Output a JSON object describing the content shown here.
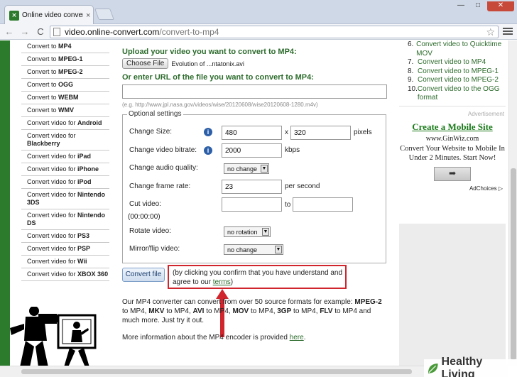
{
  "browser": {
    "tab_title": "Online video converter to",
    "tab_close": "×",
    "url_host": "video.online-convert.com",
    "url_path": "/convert-to-mp4",
    "back": "←",
    "forward": "→",
    "reload": "C",
    "star": "☆",
    "minimize": "—",
    "maximize": "□",
    "close": "✕"
  },
  "sidebar": {
    "items": [
      {
        "prefix": "Convert to ",
        "bold": "MP4"
      },
      {
        "prefix": "Convert to ",
        "bold": "MPEG-1"
      },
      {
        "prefix": "Convert to ",
        "bold": "MPEG-2"
      },
      {
        "prefix": "Convert to ",
        "bold": "OGG"
      },
      {
        "prefix": "Convert to ",
        "bold": "WEBM"
      },
      {
        "prefix": "Convert to ",
        "bold": "WMV"
      },
      {
        "prefix": "Convert video for ",
        "bold": "Android"
      },
      {
        "prefix": "Convert video for ",
        "bold": "Blackberry"
      },
      {
        "prefix": "Convert video for ",
        "bold": "iPad"
      },
      {
        "prefix": "Convert video for ",
        "bold": "iPhone"
      },
      {
        "prefix": "Convert video for ",
        "bold": "iPod"
      },
      {
        "prefix": "Convert video for ",
        "bold": "Nintendo 3DS"
      },
      {
        "prefix": "Convert video for ",
        "bold": "Nintendo DS"
      },
      {
        "prefix": "Convert video for ",
        "bold": "PS3"
      },
      {
        "prefix": "Convert video for ",
        "bold": "PSP"
      },
      {
        "prefix": "Convert video for ",
        "bold": "Wii"
      },
      {
        "prefix": "Convert video for ",
        "bold": "XBOX 360"
      }
    ]
  },
  "upload": {
    "heading": "Upload your video you want to convert to MP4:",
    "choose_label": "Choose File",
    "file_name": "Evolution of ...ntatonix.avi",
    "url_heading": "Or enter URL of the file you want to convert to MP4:",
    "url_value": "",
    "url_example": "(e.g. http://www.jpl.nasa.gov/videos/wise/20120608/wise20120608-1280.m4v)"
  },
  "options": {
    "legend": "Optional settings",
    "size_label": "Change Size:",
    "size_w": "480",
    "size_x": "x",
    "size_h": "320",
    "size_unit": "pixels",
    "bitrate_label": "Change video bitrate:",
    "bitrate_value": "2000",
    "bitrate_unit": "kbps",
    "audio_label": "Change audio quality:",
    "audio_value": "no change",
    "framerate_label": "Change frame rate:",
    "framerate_value": "23",
    "framerate_unit": "per second",
    "cut_label": "Cut video:",
    "cut_hint": "(00:00:00)",
    "cut_from": "",
    "cut_to_label": "to",
    "cut_to": "",
    "rotate_label": "Rotate video:",
    "rotate_value": "no rotation",
    "mirror_label": "Mirror/flip video:",
    "mirror_value": "no change",
    "info_icon": "i",
    "select_arrow": "▼"
  },
  "convert": {
    "button": "Convert file",
    "consent_text": "(by clicking you confirm that you have understand and agree to our ",
    "terms": "terms",
    "consent_end": ")"
  },
  "description": {
    "p1_a": "Our MP4 converter can convert from over 50 source formats for example: ",
    "p1_b": "MPEG-2",
    "p1_c": " to MP4, ",
    "p1_d": "MKV",
    "p1_e": " to MP4, ",
    "p1_f": "AVI",
    "p1_g": " to MP4, ",
    "p1_h": "MOV",
    "p1_i": " to MP4, ",
    "p1_j": "3GP",
    "p1_k": " to MP4, ",
    "p1_l": "FLV",
    "p1_m": " to MP4 and much more. Just try it out.",
    "p2_a": "More information about the MP4 encoder is provided ",
    "p2_link": "here",
    "p2_b": "."
  },
  "right": {
    "list": [
      {
        "num": "6.",
        "text": "Convert video to Quicktime MOV"
      },
      {
        "num": "7.",
        "text": "Convert video to MP4"
      },
      {
        "num": "8.",
        "text": "Convert video to MPEG-1"
      },
      {
        "num": "9.",
        "text": "Convert video to MPEG-2"
      },
      {
        "num": "10.",
        "text": "Convert video to the OGG format"
      }
    ],
    "ad_label": "Advertisement",
    "ad_title": "Create a Mobile Site",
    "ad_url": "www.GinWiz.com",
    "ad_text": "Convert Your Website to Mobile In Under 2 Minutes. Start Now!",
    "ad_arrow": "➡",
    "adchoices": "AdChoices ▷"
  },
  "watermark": {
    "text": "Healthy Living"
  },
  "colors": {
    "accent_green": "#2c7a2c",
    "link_green": "#2c6b2c",
    "highlight_red": "#d0252d"
  }
}
